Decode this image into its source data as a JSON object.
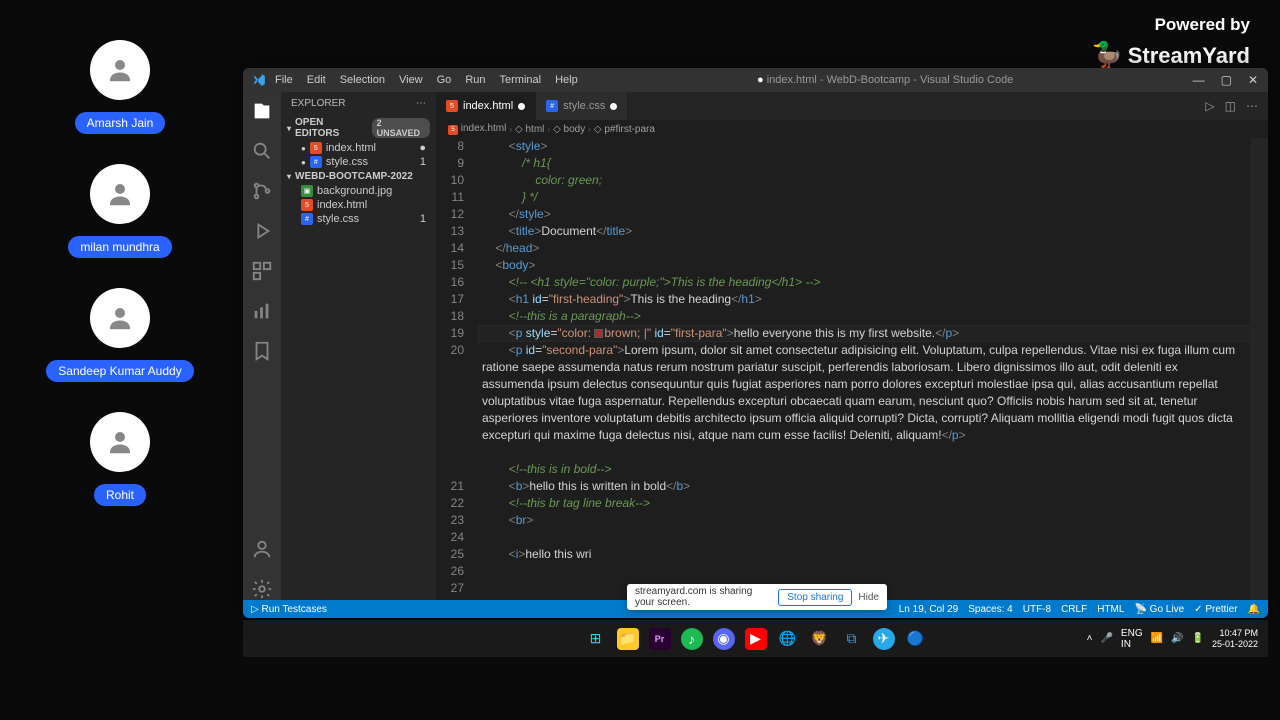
{
  "branding": {
    "powered": "Powered by",
    "name": "StreamYard"
  },
  "participants": [
    {
      "name": "Amarsh Jain"
    },
    {
      "name": "milan mundhra"
    },
    {
      "name": "Sandeep Kumar Auddy"
    },
    {
      "name": "Rohit"
    }
  ],
  "vscode": {
    "menus": [
      "File",
      "Edit",
      "Selection",
      "View",
      "Go",
      "Run",
      "Terminal",
      "Help"
    ],
    "windowTitle": "index.html - WebD-Bootcamp - Visual Studio Code",
    "sidebar": {
      "title": "EXPLORER",
      "openEditors": {
        "label": "OPEN EDITORS",
        "badge": "2 UNSAVED"
      },
      "openFiles": [
        {
          "name": "index.html",
          "type": "html",
          "dirty": "●"
        },
        {
          "name": "style.css",
          "type": "css",
          "dirty": "1"
        }
      ],
      "project": "WEBD-BOOTCAMP-2022",
      "projectFiles": [
        {
          "name": "background.jpg",
          "type": "img",
          "dirty": ""
        },
        {
          "name": "index.html",
          "type": "html",
          "dirty": ""
        },
        {
          "name": "style.css",
          "type": "css",
          "dirty": "1"
        }
      ]
    },
    "tabs": [
      {
        "name": "index.html",
        "type": "html",
        "active": true,
        "dirty": true
      },
      {
        "name": "style.css",
        "type": "css",
        "active": false,
        "dirty": true
      }
    ],
    "breadcrumbs": [
      "index.html",
      "html",
      "body",
      "p#first-para"
    ],
    "code": {
      "startLine": 8,
      "lines": [
        {
          "n": 8,
          "html": "        <span class='tok-brk'>&lt;</span><span class='tok-tag'>style</span><span class='tok-brk'>&gt;</span>"
        },
        {
          "n": 9,
          "html": "            <span class='tok-com'>/* h1{</span>"
        },
        {
          "n": 10,
          "html": "                <span class='tok-com'>color: green;</span>"
        },
        {
          "n": 11,
          "html": "            <span class='tok-com'>} */</span>"
        },
        {
          "n": 12,
          "html": "        <span class='tok-brk'>&lt;/</span><span class='tok-tag'>style</span><span class='tok-brk'>&gt;</span>"
        },
        {
          "n": 13,
          "html": "        <span class='tok-brk'>&lt;</span><span class='tok-tag'>title</span><span class='tok-brk'>&gt;</span><span class='tok-title'>Document</span><span class='tok-brk'>&lt;/</span><span class='tok-tag'>title</span><span class='tok-brk'>&gt;</span>"
        },
        {
          "n": 14,
          "html": "    <span class='tok-brk'>&lt;/</span><span class='tok-tag'>head</span><span class='tok-brk'>&gt;</span>"
        },
        {
          "n": 15,
          "html": "    <span class='tok-brk'>&lt;</span><span class='tok-tag'>body</span><span class='tok-brk'>&gt;</span>"
        },
        {
          "n": 16,
          "html": "        <span class='tok-com'>&lt;!-- &lt;h1 style=&quot;color: purple;&quot;&gt;This is the heading&lt;/h1&gt; --&gt;</span>"
        },
        {
          "n": 17,
          "html": "        <span class='tok-brk'>&lt;</span><span class='tok-tag'>h1</span> <span class='tok-attr'>id</span>=<span class='tok-str'>&quot;first-heading&quot;</span><span class='tok-brk'>&gt;</span><span class='tok-txt'>This is the heading</span><span class='tok-brk'>&lt;/</span><span class='tok-tag'>h1</span><span class='tok-brk'>&gt;</span>"
        },
        {
          "n": 18,
          "html": "        <span class='tok-com'>&lt;!--this is a paragraph--&gt;</span>"
        },
        {
          "n": 19,
          "html": "        <span class='tok-brk'>&lt;</span><span class='tok-tag'>p</span> <span class='tok-attr'>style</span>=<span class='tok-str'>&quot;color: <span class='color-swatch'></span>brown; |&quot;</span> <span class='tok-attr'>id</span>=<span class='tok-str'>&quot;first-para&quot;</span><span class='tok-brk'>&gt;</span><span class='tok-txt'>hello everyone this is my first website.</span><span class='tok-brk'>&lt;/</span><span class='tok-tag'>p</span><span class='tok-brk'>&gt;</span>",
          "hl": true
        },
        {
          "n": 20,
          "html": "        <span class='tok-brk'>&lt;</span><span class='tok-tag'>p</span> <span class='tok-attr'>id</span>=<span class='tok-str'>&quot;second-para&quot;</span><span class='tok-brk'>&gt;</span><span class='tok-txt'>Lorem ipsum, dolor sit amet consectetur adipisicing elit. Voluptatum, culpa repellendus. Vitae nisi ex fuga illum cum ratione saepe assumenda natus rerum nostrum pariatur suscipit, perferendis laboriosam. Libero dignissimos illo aut, odit deleniti ex assumenda ipsum delectus consequuntur quis fugiat asperiores nam porro dolores excepturi molestiae ipsa qui, alias accusantium repellat voluptatibus vitae fuga aspernatur. Repellendus excepturi obcaecati quam earum, nesciunt quo? Officiis nobis harum sed sit at, tenetur asperiores inventore voluptatum debitis architecto ipsum officia aliquid corrupti? Dicta, corrupti? Aliquam mollitia eligendi modi fugit quos dicta excepturi qui maxime fuga delectus nisi, atque nam cum esse facilis! Deleniti, aliquam!</span><span class='tok-brk'>&lt;/</span><span class='tok-tag'>p</span><span class='tok-brk'>&gt;</span>",
          "wrap": true
        },
        {
          "n": 21,
          "html": ""
        },
        {
          "n": 22,
          "html": "        <span class='tok-com'>&lt;!--this is in bold--&gt;</span>"
        },
        {
          "n": 23,
          "html": "        <span class='tok-brk'>&lt;</span><span class='tok-tag'>b</span><span class='tok-brk'>&gt;</span><span class='tok-txt'>hello this is written in bold</span><span class='tok-brk'>&lt;/</span><span class='tok-tag'>b</span><span class='tok-brk'>&gt;</span>"
        },
        {
          "n": 24,
          "html": "        <span class='tok-com'>&lt;!--this br tag line break--&gt;</span>"
        },
        {
          "n": 25,
          "html": "        <span class='tok-brk'>&lt;</span><span class='tok-tag'>br</span><span class='tok-brk'>&gt;</span>"
        },
        {
          "n": 26,
          "html": ""
        },
        {
          "n": 27,
          "html": "        <span class='tok-brk'>&lt;</span><span class='tok-tag'>i</span><span class='tok-brk'>&gt;</span><span class='tok-txt'>hello this wri</span>"
        }
      ]
    },
    "status": {
      "runTestcases": "Run Testcases",
      "lnCol": "Ln 19, Col 29",
      "spaces": "Spaces: 4",
      "encoding": "UTF-8",
      "eol": "CRLF",
      "lang": "HTML",
      "golive": "Go Live",
      "prettier": "Prettier"
    }
  },
  "shareBar": {
    "msg": "streamyard.com is sharing your screen.",
    "stop": "Stop sharing",
    "hide": "Hide"
  },
  "taskbar": {
    "lang": "ENG",
    "region": "IN",
    "time": "10:47 PM",
    "date": "25-01-2022"
  }
}
